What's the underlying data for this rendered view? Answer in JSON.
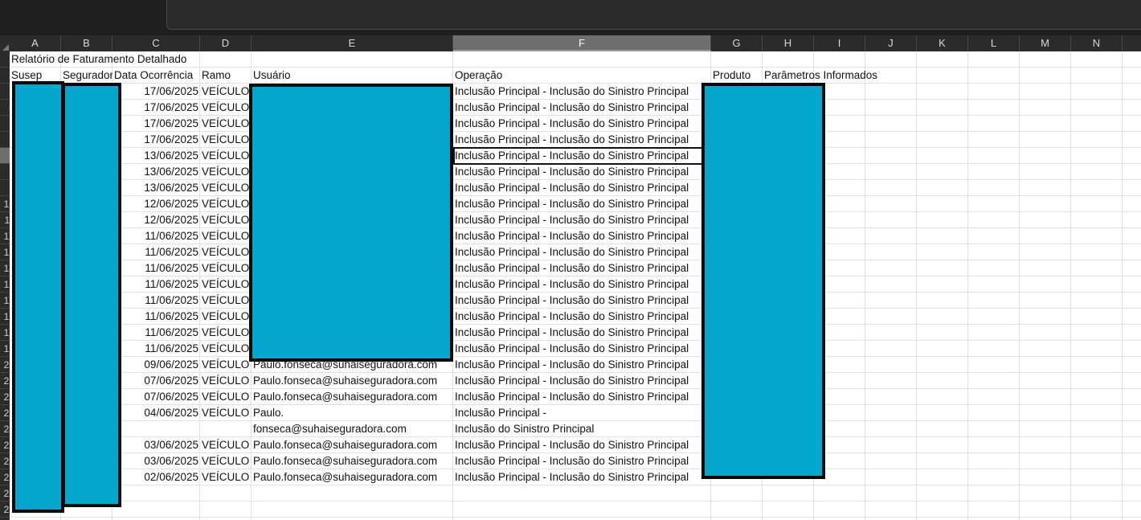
{
  "columns": [
    "A",
    "B",
    "C",
    "D",
    "E",
    "F",
    "G",
    "H",
    "I",
    "J",
    "K",
    "L",
    "M",
    "N"
  ],
  "selected_column": "F",
  "row_numbers": [
    "1",
    "2",
    "3",
    "4",
    "5",
    "6",
    "7",
    "8",
    "9",
    "10",
    "11",
    "12",
    "13",
    "14",
    "15",
    "16",
    "17",
    "18",
    "19",
    "20",
    "21",
    "22",
    "23",
    "24",
    "25",
    "26",
    "27",
    "28",
    "29"
  ],
  "selected_row": "7",
  "title_cell": "Relatório de Faturamento Detalhado",
  "headers": {
    "susep": "Susep",
    "seguradora": "Seguradora",
    "data": "Data Ocorrência",
    "ramo": "Ramo",
    "usuario": "Usuário",
    "operacao": "Operação",
    "produto": "Produto",
    "parametros": "Parâmetros Informados"
  },
  "rows": [
    {
      "date": "17/06/2025",
      "ramo": "VEÍCULO",
      "user": "",
      "op": "Inclusão Principal - Inclusão do Sinistro Principal"
    },
    {
      "date": "17/06/2025",
      "ramo": "VEÍCULO",
      "user": "",
      "op": "Inclusão Principal - Inclusão do Sinistro Principal"
    },
    {
      "date": "17/06/2025",
      "ramo": "VEÍCULO",
      "user": "",
      "op": "Inclusão Principal - Inclusão do Sinistro Principal"
    },
    {
      "date": "17/06/2025",
      "ramo": "VEÍCULO",
      "user": "",
      "op": "Inclusão Principal - Inclusão do Sinistro Principal"
    },
    {
      "date": "13/06/2025",
      "ramo": "VEÍCULO",
      "user": "",
      "op": "Inclusão Principal - Inclusão do Sinistro Principal"
    },
    {
      "date": "13/06/2025",
      "ramo": "VEÍCULO",
      "user": "",
      "op": "Inclusão Principal - Inclusão do Sinistro Principal"
    },
    {
      "date": "13/06/2025",
      "ramo": "VEÍCULO",
      "user": "",
      "op": "Inclusão Principal - Inclusão do Sinistro Principal"
    },
    {
      "date": "12/06/2025",
      "ramo": "VEÍCULO",
      "user": "",
      "op": "Inclusão Principal - Inclusão do Sinistro Principal"
    },
    {
      "date": "12/06/2025",
      "ramo": "VEÍCULO",
      "user": "",
      "op": "Inclusão Principal - Inclusão do Sinistro Principal"
    },
    {
      "date": "11/06/2025",
      "ramo": "VEÍCULO",
      "user": "",
      "op": "Inclusão Principal - Inclusão do Sinistro Principal"
    },
    {
      "date": "11/06/2025",
      "ramo": "VEÍCULO",
      "user": "",
      "op": "Inclusão Principal - Inclusão do Sinistro Principal"
    },
    {
      "date": "11/06/2025",
      "ramo": "VEÍCULO",
      "user": "",
      "op": "Inclusão Principal - Inclusão do Sinistro Principal"
    },
    {
      "date": "11/06/2025",
      "ramo": "VEÍCULO",
      "user": "",
      "op": "Inclusão Principal - Inclusão do Sinistro Principal"
    },
    {
      "date": "11/06/2025",
      "ramo": "VEÍCULO",
      "user": "",
      "op": "Inclusão Principal - Inclusão do Sinistro Principal"
    },
    {
      "date": "11/06/2025",
      "ramo": "VEÍCULO",
      "user": "",
      "op": "Inclusão Principal - Inclusão do Sinistro Principal"
    },
    {
      "date": "11/06/2025",
      "ramo": "VEÍCULO",
      "user": "",
      "op": "Inclusão Principal - Inclusão do Sinistro Principal"
    },
    {
      "date": "11/06/2025",
      "ramo": "VEÍCULO",
      "user": "",
      "op": "Inclusão Principal - Inclusão do Sinistro Principal"
    },
    {
      "date": "09/06/2025",
      "ramo": "VEÍCULO",
      "user": "Paulo.fonseca@suhaiseguradora.com",
      "op": "Inclusão Principal - Inclusão do Sinistro Principal"
    },
    {
      "date": "07/06/2025",
      "ramo": "VEÍCULO",
      "user": "Paulo.fonseca@suhaiseguradora.com",
      "op": "Inclusão Principal - Inclusão do Sinistro Principal"
    },
    {
      "date": "07/06/2025",
      "ramo": "VEÍCULO",
      "user": "Paulo.fonseca@suhaiseguradora.com",
      "op": "Inclusão Principal - Inclusão do Sinistro Principal"
    },
    {
      "date": "04/06/2025",
      "ramo": "VEÍCULO",
      "user": "Paulo.",
      "op": "Inclusão Principal -"
    },
    {
      "date": "",
      "ramo": "",
      "user": "fonseca@suhaiseguradora.com",
      "op": "Inclusão do Sinistro Principal"
    },
    {
      "date": "03/06/2025",
      "ramo": "VEÍCULO",
      "user": "Paulo.fonseca@suhaiseguradora.com",
      "op": "Inclusão Principal - Inclusão do Sinistro Principal"
    },
    {
      "date": "03/06/2025",
      "ramo": "VEÍCULO",
      "user": "Paulo.fonseca@suhaiseguradora.com",
      "op": "Inclusão Principal - Inclusão do Sinistro Principal"
    },
    {
      "date": "02/06/2025",
      "ramo": "VEÍCULO",
      "user": "Paulo.fonseca@suhaiseguradora.com",
      "op": "Inclusão Principal - Inclusão do Sinistro Principal"
    }
  ],
  "redaction_color": "#03a6cc"
}
